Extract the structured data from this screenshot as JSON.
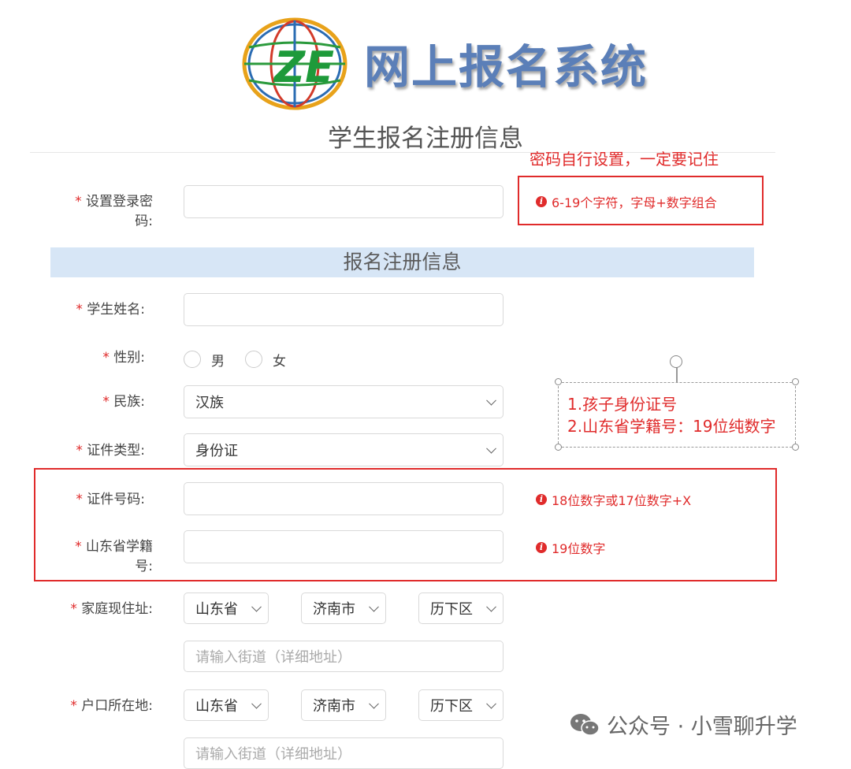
{
  "header": {
    "system_title": "网上报名系统",
    "form_title": "学生报名注册信息",
    "logo_text": "ZE"
  },
  "annotations": {
    "password_note": "密码自行设置，一定要记住",
    "callout_line1": "1.孩子身份证号",
    "callout_line2": "2.山东省学籍号：19位纯数字"
  },
  "password": {
    "required_mark": "*",
    "label": "设置登录密码:",
    "value": "",
    "hint": "6-19个字符，字母+数字组合"
  },
  "section": {
    "title": "报名注册信息"
  },
  "student_name": {
    "required_mark": "*",
    "label": "学生姓名:",
    "value": ""
  },
  "gender": {
    "required_mark": "*",
    "label": "性别:",
    "options": [
      "男",
      "女"
    ]
  },
  "ethnicity": {
    "required_mark": "*",
    "label": "民族:",
    "selected": "汉族"
  },
  "id_type": {
    "required_mark": "*",
    "label": "证件类型:",
    "selected": "身份证"
  },
  "id_number": {
    "required_mark": "*",
    "label": "证件号码:",
    "value": "",
    "hint": "18位数字或17位数字+X"
  },
  "student_no": {
    "required_mark": "*",
    "label": "山东省学籍号:",
    "value": "",
    "hint": "19位数字"
  },
  "home_address": {
    "required_mark": "*",
    "label": "家庭现住址:",
    "province": "山东省",
    "city": "济南市",
    "district": "历下区",
    "street_placeholder": "请输入街道（详细地址）"
  },
  "household_address": {
    "required_mark": "*",
    "label": "户口所在地:",
    "province": "山东省",
    "city": "济南市",
    "district": "历下区",
    "street_placeholder": "请输入街道（详细地址）"
  },
  "watermark": {
    "text": "公众号 · 小雪聊升学",
    "icon": "wechat-icon"
  },
  "colors": {
    "accent_red": "#e02b2b",
    "section_band": "#d7e6f6",
    "title_blue": "#5b7fb8"
  }
}
